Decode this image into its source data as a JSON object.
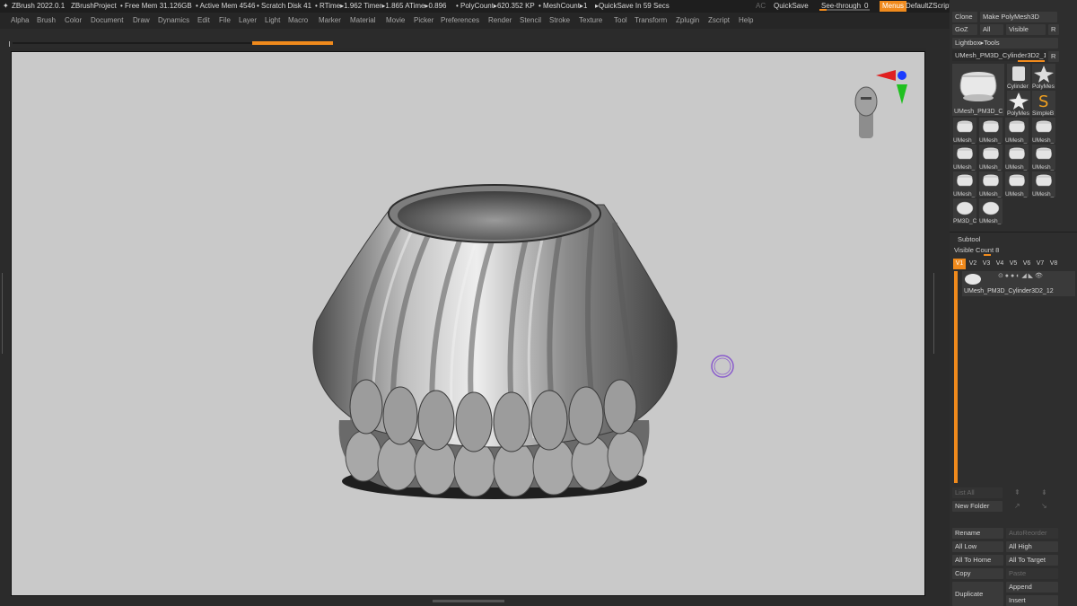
{
  "titlebar": {
    "app": "ZBrush 2022.0.1",
    "project": "ZBrushProject",
    "free_mem": "• Free Mem 31.126GB",
    "active_mem": "• Active Mem 4546",
    "scratch": "• Scratch Disk 41",
    "rtime": "• RTime▸1.962 Timer▸1.865 ATime▸0.896",
    "polycount": "• PolyCount▸620.352 KP",
    "meshcount": "• MeshCount▸1",
    "quicksave_in": "▸QuickSave In 59 Secs",
    "ac": "AC",
    "quicksave": "QuickSave",
    "see_through": "See-through",
    "see_through_value": "0",
    "menus": "Menus",
    "default_zscript": "DefaultZScript"
  },
  "menubar": [
    "Alpha",
    "Brush",
    "Color",
    "Document",
    "Draw",
    "Dynamics",
    "Edit",
    "File",
    "Layer",
    "Light",
    "Macro",
    "Marker",
    "Material",
    "Movie",
    "Picker",
    "Preferences",
    "Render",
    "Stencil",
    "Stroke",
    "Texture",
    "Tool",
    "Transform",
    "Zplugin",
    "Zscript",
    "Help"
  ],
  "tool_panel": {
    "clone": "Clone",
    "make_polymesh": "Make PolyMesh3D",
    "goz": "GoZ",
    "all": "All",
    "visible": "Visible",
    "r": "R",
    "lightbox_tools": "Lightbox▸Tools",
    "current_tool": "UMesh_PM3D_Cylinder3D2_1",
    "r2": "R",
    "main_thumb_caption": "UMesh_PM3D_C",
    "thumbs_top": [
      "Cylinder",
      "PolyMes",
      "PolyMes",
      "SimpleB"
    ],
    "thumb_caption": "UMesh_",
    "last_row": [
      "PM3D_C",
      "UMesh_"
    ]
  },
  "subtool_panel": {
    "title": "Subtool",
    "visible_count": "Visible Count 8",
    "tabs": [
      "V1",
      "V2",
      "V3",
      "V4",
      "V5",
      "V6",
      "V7",
      "V8"
    ],
    "item_name": "UMesh_PM3D_Cylinder3D2_12",
    "list_all": "List All",
    "new_folder": "New Folder",
    "rename": "Rename",
    "auto_reorder": "AutoReorder",
    "all_low": "All Low",
    "all_high": "All High",
    "all_to_home": "All To Home",
    "all_to_target": "All To Target",
    "copy": "Copy",
    "paste": "Paste",
    "duplicate": "Duplicate",
    "append": "Append",
    "insert": "Insert"
  },
  "colors": {
    "accent": "#f08a1c",
    "canvas_bg": "#c9c9c9",
    "panel_bg": "#2e2e2e"
  }
}
